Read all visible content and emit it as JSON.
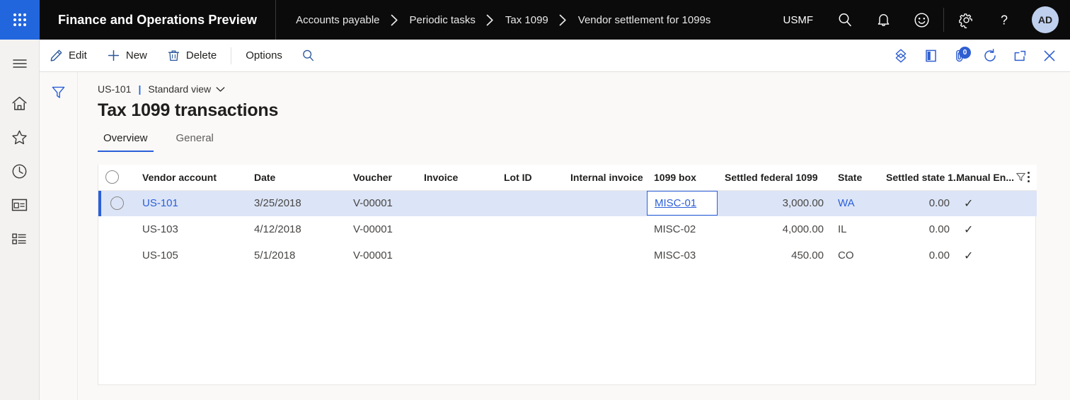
{
  "topbar": {
    "waffle_label": "waffle",
    "app_title": "Finance and Operations Preview",
    "breadcrumb": [
      "Accounts payable",
      "Periodic tasks",
      "Tax 1099",
      "Vendor settlement for 1099s"
    ],
    "company": "USMF",
    "icons": [
      "search-icon",
      "notifications-icon",
      "feedback-smiley-icon",
      "settings-gear-icon",
      "help-question-icon"
    ],
    "avatar_initials": "AD",
    "accent_blue": "#2266dd",
    "bar_background": "#0b0b0b"
  },
  "rail": {
    "items": [
      "hamburger-menu-icon",
      "home-icon",
      "favorites-star-icon",
      "recent-clock-icon",
      "workspaces-icon",
      "modules-list-icon"
    ]
  },
  "actionpane": {
    "edit_label": "Edit",
    "new_label": "New",
    "delete_label": "Delete",
    "options_label": "Options",
    "search_label": "search-icon",
    "right_icons": [
      "attach-gem-icon",
      "office-app-icon",
      "attachments-icon",
      "refresh-icon",
      "open-in-new-window-icon",
      "close-icon"
    ],
    "attachments_count": "0"
  },
  "filter_rail": {
    "filter_label": "filter-pane-icon"
  },
  "page": {
    "record_id": "US-101",
    "separator": "|",
    "view_name": "Standard view",
    "title": "Tax 1099 transactions",
    "tabs": [
      {
        "label": "Overview",
        "active": true
      },
      {
        "label": "General",
        "active": false
      }
    ]
  },
  "grid": {
    "columns": [
      {
        "key": "select",
        "label": ""
      },
      {
        "key": "vendor_account",
        "label": "Vendor account"
      },
      {
        "key": "date",
        "label": "Date"
      },
      {
        "key": "voucher",
        "label": "Voucher"
      },
      {
        "key": "invoice",
        "label": "Invoice"
      },
      {
        "key": "lot_id",
        "label": "Lot ID"
      },
      {
        "key": "internal_invoice",
        "label": "Internal invoice"
      },
      {
        "key": "box_1099",
        "label": "1099 box"
      },
      {
        "key": "settled_federal_1099",
        "label": "Settled federal 1099"
      },
      {
        "key": "state",
        "label": "State"
      },
      {
        "key": "settled_state",
        "label": "Settled state 1..."
      },
      {
        "key": "manual_entry",
        "label": "Manual En..."
      }
    ],
    "header_tools": [
      "column-filter-icon",
      "grid-options-icon"
    ],
    "rows": [
      {
        "selected": true,
        "vendor_account": "US-101",
        "date": "3/25/2018",
        "voucher": "V-00001",
        "invoice": "",
        "lot_id": "",
        "internal_invoice": "",
        "box_1099": "MISC-01",
        "settled_federal_1099": "3,000.00",
        "state": "WA",
        "settled_state": "0.00",
        "manual_entry": "✓"
      },
      {
        "selected": false,
        "vendor_account": "US-103",
        "date": "4/12/2018",
        "voucher": "V-00001",
        "invoice": "",
        "lot_id": "",
        "internal_invoice": "",
        "box_1099": "MISC-02",
        "settled_federal_1099": "4,000.00",
        "state": "IL",
        "settled_state": "0.00",
        "manual_entry": "✓"
      },
      {
        "selected": false,
        "vendor_account": "US-105",
        "date": "5/1/2018",
        "voucher": "V-00001",
        "invoice": "",
        "lot_id": "",
        "internal_invoice": "",
        "box_1099": "MISC-03",
        "settled_federal_1099": "450.00",
        "state": "CO",
        "settled_state": "0.00",
        "manual_entry": "✓"
      }
    ],
    "active_cell": {
      "row": 0,
      "column": "box_1099"
    },
    "selection_color": "#dce5f7",
    "accent_color": "#2b5fd9"
  }
}
